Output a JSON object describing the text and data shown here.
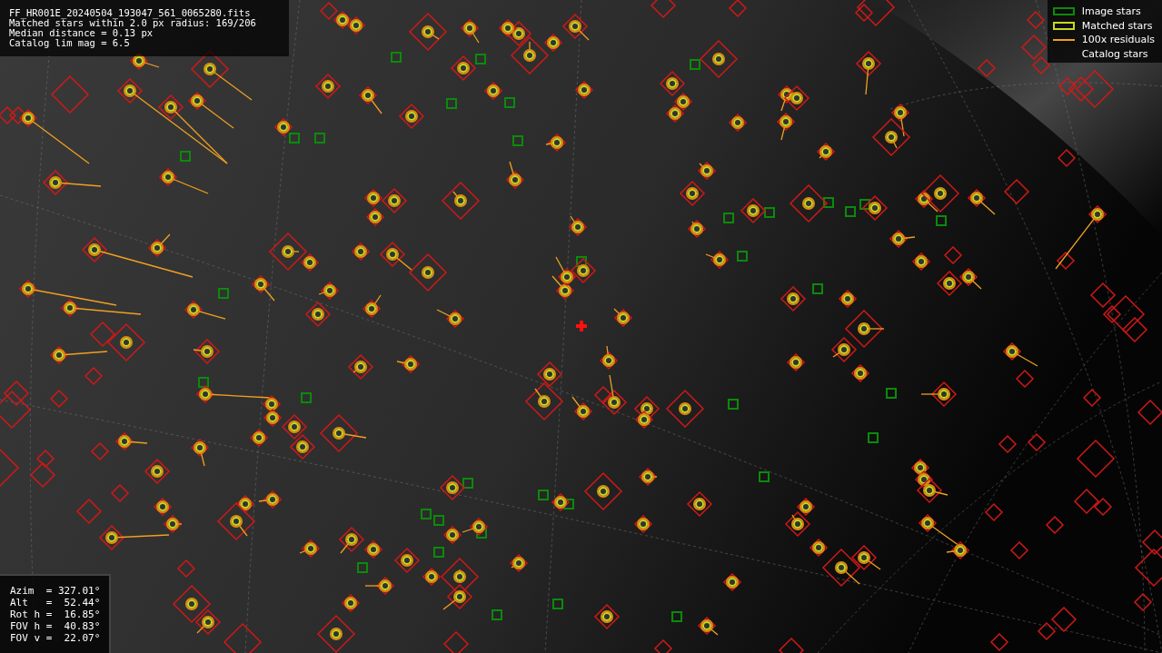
{
  "info_box": {
    "lines": [
      "FF_HR001E_20240504_193047_561_0065280.fits",
      "Matched stars within 2.0 px radius: 169/206",
      "Median distance = 0.13 px",
      "Catalog lim mag = 6.5"
    ]
  },
  "legend": [
    {
      "kind": "image",
      "label": "Image stars"
    },
    {
      "kind": "matched",
      "label": "Matched stars"
    },
    {
      "kind": "residual",
      "label": "100x residuals"
    },
    {
      "kind": "catalog",
      "label": "Catalog stars"
    }
  ],
  "pointing": {
    "lines": [
      "Azim  = 327.01°",
      "Alt   =  52.44°",
      "Rot h =  16.85°",
      "FOV h =  40.83°",
      "FOV v =  22.07°"
    ]
  }
}
